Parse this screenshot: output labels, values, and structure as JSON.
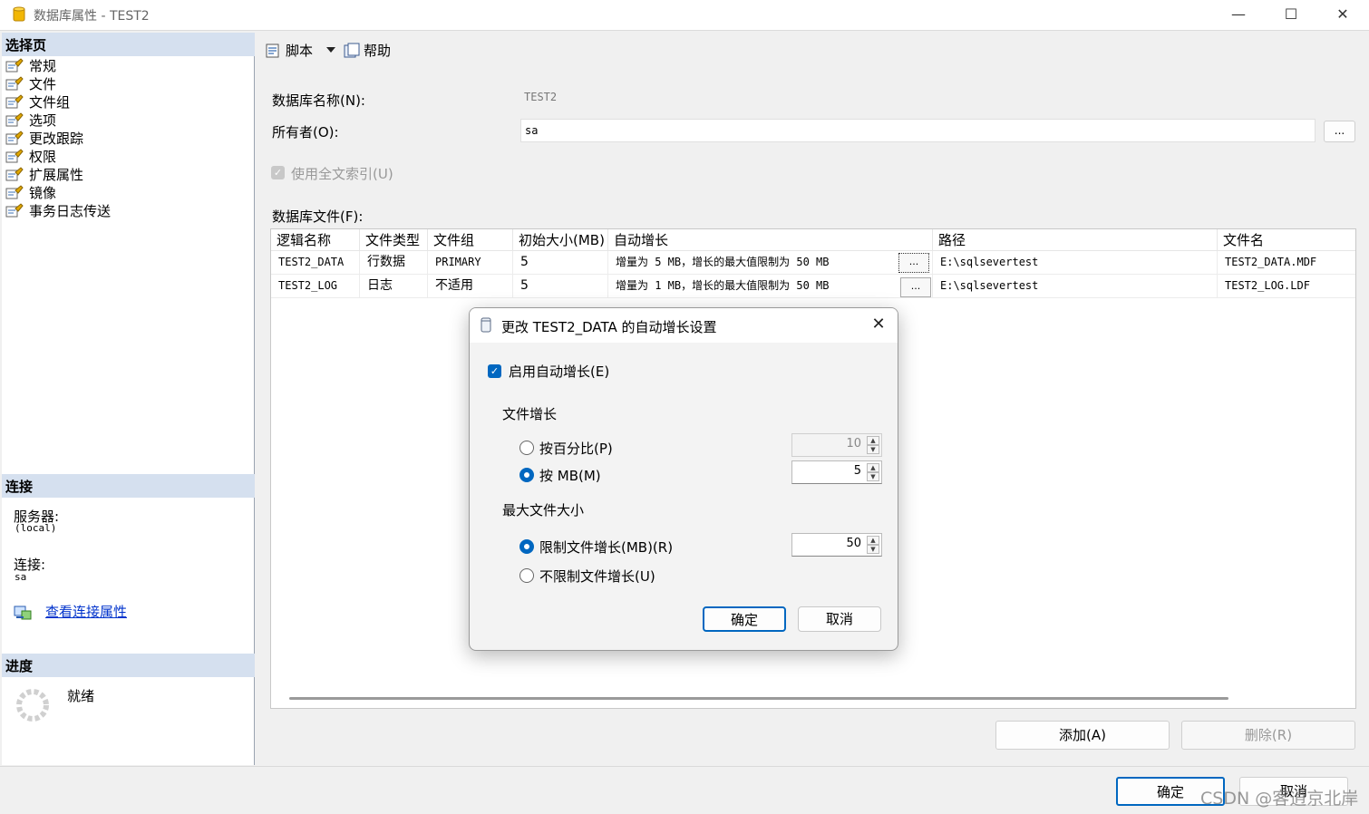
{
  "window": {
    "title": "数据库属性 - TEST2",
    "controls": {
      "minimize": "—",
      "maximize": "☐",
      "close": "✕"
    }
  },
  "sidebar": {
    "select_page_heading": "选择页",
    "pages": [
      "常规",
      "文件",
      "文件组",
      "选项",
      "更改跟踪",
      "权限",
      "扩展属性",
      "镜像",
      "事务日志传送"
    ],
    "connection_heading": "连接",
    "server_label": "服务器:",
    "server_value": "(local)",
    "connection_label": "连接:",
    "connection_value": "sa",
    "view_connection_link": "查看连接属性",
    "progress_heading": "进度",
    "progress_status": "就绪"
  },
  "toolbar": {
    "script_label": "脚本",
    "help_label": "帮助"
  },
  "form": {
    "db_name_label": "数据库名称(N):",
    "db_name_value": "TEST2",
    "owner_label": "所有者(O):",
    "owner_value": "sa",
    "browse_label": "...",
    "fulltext_label": "使用全文索引(U)",
    "files_label": "数据库文件(F):"
  },
  "files_table": {
    "columns": [
      "逻辑名称",
      "文件类型",
      "文件组",
      "初始大小(MB)",
      "自动增长",
      "路径",
      "文件名"
    ],
    "rows": [
      {
        "logical": "TEST2_DATA",
        "type": "行数据",
        "group": "PRIMARY",
        "size": "5",
        "growth": "增量为 5 MB，增长的最大值限制为 50 MB",
        "btn": "...",
        "path": "E:\\sqlsevertest",
        "file": "TEST2_DATA.MDF"
      },
      {
        "logical": "TEST2_LOG",
        "type": "日志",
        "group": "不适用",
        "size": "5",
        "growth": "增量为 1 MB，增长的最大值限制为 50 MB",
        "btn": "...",
        "path": "E:\\sqlsevertest",
        "file": "TEST2_LOG.LDF"
      }
    ]
  },
  "buttons": {
    "add": "添加(A)",
    "delete": "删除(R)",
    "ok": "确定",
    "cancel": "取消"
  },
  "watermark": "CSDN @客逍京北岸",
  "dialog": {
    "title": "更改 TEST2_DATA 的自动增长设置",
    "close": "✕",
    "enable_autogrow_label": "启用自动增长(E)",
    "enable_autogrow_checked": true,
    "file_growth_heading": "文件增长",
    "by_percent_label": "按百分比(P)",
    "by_percent_value": "10",
    "by_mb_label": "按 MB(M)",
    "by_mb_value": "5",
    "growth_mode": "mb",
    "max_size_heading": "最大文件大小",
    "limited_label": "限制文件增长(MB)(R)",
    "limited_value": "50",
    "unlimited_label": "不限制文件增长(U)",
    "max_mode": "limited",
    "ok": "确定",
    "cancel": "取消"
  }
}
